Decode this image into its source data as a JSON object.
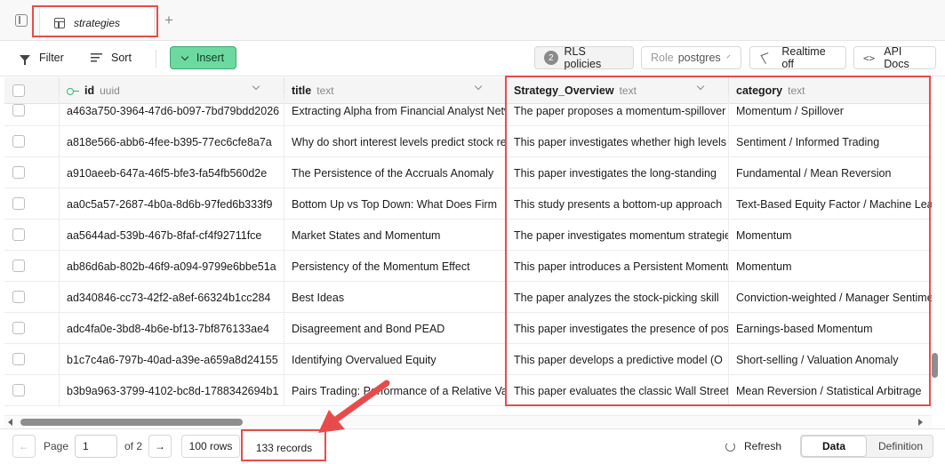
{
  "tab": {
    "label": "strategies"
  },
  "toolbar": {
    "filter_label": "Filter",
    "sort_label": "Sort",
    "insert_label": "Insert",
    "rls_count": "2",
    "rls_label": "RLS policies",
    "role_label": "Role",
    "role_value": "postgres",
    "realtime_label": "Realtime off",
    "api_label": "API Docs"
  },
  "columns": [
    {
      "name": "id",
      "type": "uuid"
    },
    {
      "name": "title",
      "type": "text"
    },
    {
      "name": "Strategy_Overview",
      "type": "text"
    },
    {
      "name": "category",
      "type": "text"
    }
  ],
  "rows": [
    {
      "id": "a463a750-3964-47d6-b097-7bd79bdd2026",
      "title": "Extracting Alpha from Financial Analyst Networks",
      "overview": "The paper proposes a momentum-spillover",
      "category": "Momentum / Spillover"
    },
    {
      "id": "a818e566-abb6-4fee-b395-77ec6cfe8a7a",
      "title": "Why do short interest levels predict stock returns",
      "overview": "This paper investigates whether high levels",
      "category": "Sentiment / Informed Trading"
    },
    {
      "id": "a910aeeb-647a-46f5-bfe3-fa54fb560d2e",
      "title": "The Persistence of the Accruals Anomaly",
      "overview": "This paper investigates the long-standing",
      "category": "Fundamental / Mean Reversion"
    },
    {
      "id": "aa0c5a57-2687-4b0a-8d6b-97fed6b333f9",
      "title": "Bottom Up vs Top Down: What Does Firm",
      "overview": "This study presents a bottom-up approach",
      "category": "Text-Based Equity Factor / Machine Learning"
    },
    {
      "id": "aa5644ad-539b-467b-8faf-cf4f92711fce",
      "title": "Market States and Momentum",
      "overview": "The paper investigates momentum strategies",
      "category": "Momentum"
    },
    {
      "id": "ab86d6ab-802b-46f9-a094-9799e6bbe51a",
      "title": "Persistency of the Momentum Effect",
      "overview": "This paper introduces a Persistent Momentum",
      "category": "Momentum"
    },
    {
      "id": "ad340846-cc73-42f2-a8ef-66324b1cc284",
      "title": "Best Ideas",
      "overview": "The paper analyzes the stock-picking skill",
      "category": "Conviction-weighted / Manager Sentiment"
    },
    {
      "id": "adc4fa0e-3bd8-4b6e-bf13-7bf876133ae4",
      "title": "Disagreement and Bond PEAD",
      "overview": "This paper investigates the presence of post",
      "category": "Earnings-based Momentum"
    },
    {
      "id": "b1c7c4a6-797b-40ad-a39e-a659a8d24155",
      "title": "Identifying Overvalued Equity",
      "overview": "This paper develops a predictive model (O",
      "category": "Short-selling / Valuation Anomaly"
    },
    {
      "id": "b3b9a963-3799-4102-bc8d-1788342694b1",
      "title": "Pairs Trading: Performance of a Relative Value",
      "overview": "This paper evaluates the classic Wall Street",
      "category": "Mean Reversion / Statistical Arbitrage"
    }
  ],
  "footer": {
    "page_label": "Page",
    "page_value": "1",
    "of_label": "of 2",
    "rows_label": "100 rows",
    "records_label": "133 records",
    "refresh_label": "Refresh",
    "data_label": "Data",
    "definition_label": "Definition"
  },
  "colors": {
    "accent": "#6cd9a1",
    "annotation": "#e74c4c"
  }
}
